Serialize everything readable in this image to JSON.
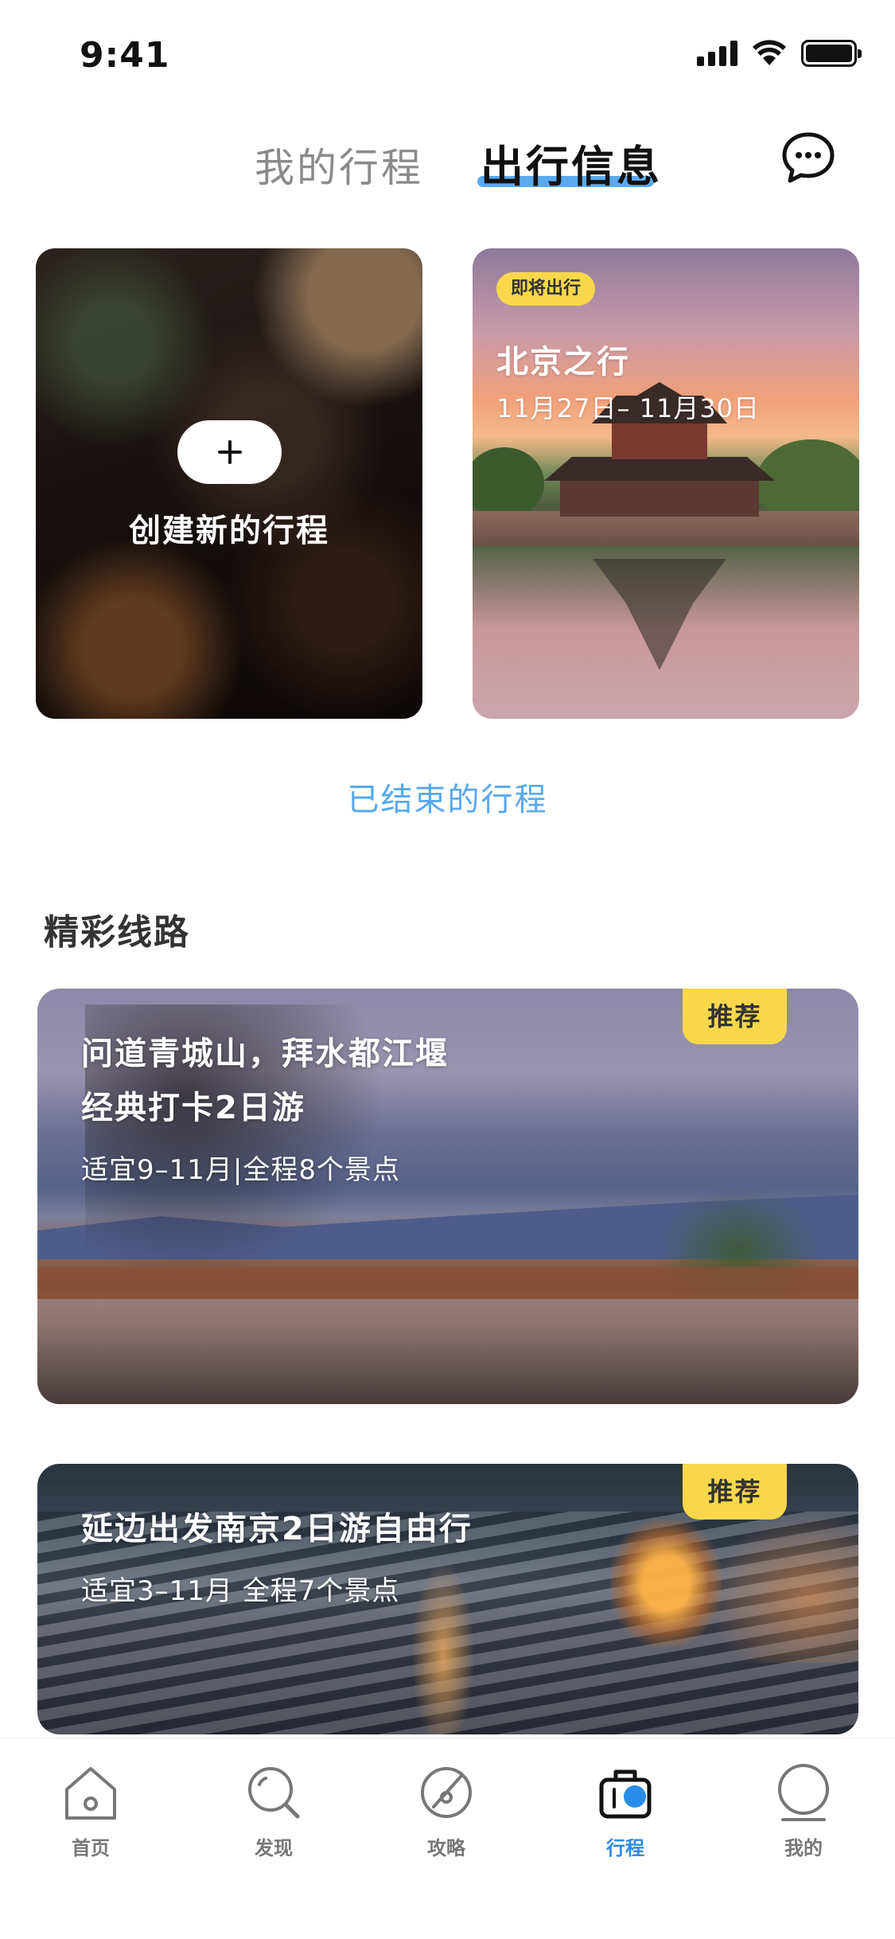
{
  "status_bar": {
    "time": "9:41"
  },
  "top_tabs": {
    "mine": "我的行程",
    "info": "出行信息"
  },
  "create_card": {
    "label": "创建新的行程"
  },
  "trip_card": {
    "badge": "即将出行",
    "title": "北京之行",
    "date": "11月27日– 11月30日"
  },
  "ended_link": "已结束的行程",
  "section": {
    "title": "精彩线路"
  },
  "routes": [
    {
      "badge": "推荐",
      "title_lines": [
        "问道青城山，拜水都江堰",
        "经典打卡2日游"
      ],
      "subtitle": "适宜9–11月|全程8个景点"
    },
    {
      "badge": "推荐",
      "title_lines": [
        "延边出发南京2日游自由行"
      ],
      "subtitle": "适宜3–11月  全程7个景点"
    }
  ],
  "tabbar": {
    "items": [
      {
        "label": "首页",
        "icon": "home-icon"
      },
      {
        "label": "发现",
        "icon": "discover-icon"
      },
      {
        "label": "攻略",
        "icon": "guide-icon"
      },
      {
        "label": "行程",
        "icon": "trip-icon",
        "active": true
      },
      {
        "label": "我的",
        "icon": "profile-icon"
      }
    ]
  },
  "colors": {
    "accent": "#2a8ce8",
    "link": "#58a8ec",
    "badge": "#f8d84a",
    "tab_underline": "#5aaaf0"
  }
}
